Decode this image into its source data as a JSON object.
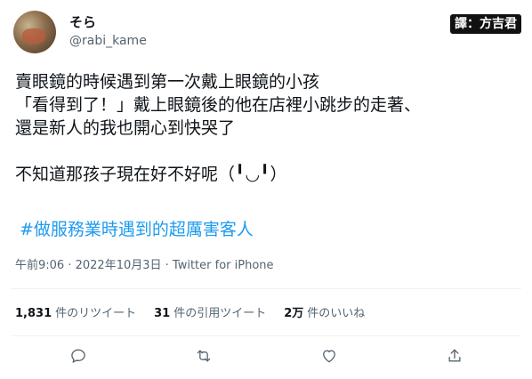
{
  "author": {
    "display_name": "そら",
    "handle": "@rabi_kame"
  },
  "translator_badge": "譯：方吉君",
  "tweet": {
    "lines": [
      "賣眼鏡的時候遇到第一次戴上眼鏡的小孩",
      "「看得到了！」戴上眼鏡後的他在店裡小跳步的走著、",
      "還是新人的我也開心到快哭了",
      "不知道那孩子現在好不好呢（╹◡╹）"
    ],
    "hashtag": "#做服務業時遇到的超厲害客人"
  },
  "meta": {
    "time": "午前9:06",
    "separator1": " · ",
    "date": "2022年10月3日",
    "separator2": " · ",
    "source": "Twitter for iPhone"
  },
  "stats": {
    "retweets_count": "1,831",
    "retweets_label": "件のリツイート",
    "quotes_count": "31",
    "quotes_label": "件の引用ツイート",
    "likes_count": "2万",
    "likes_label": "件のいいね"
  },
  "actions": {
    "reply_icon": "reply-icon",
    "retweet_icon": "retweet-icon",
    "like_icon": "heart-icon",
    "share_icon": "share-icon"
  },
  "colors": {
    "text": "#0f1419",
    "secondary": "#536471",
    "link": "#1d9bf0",
    "divider": "#eff3f4"
  }
}
